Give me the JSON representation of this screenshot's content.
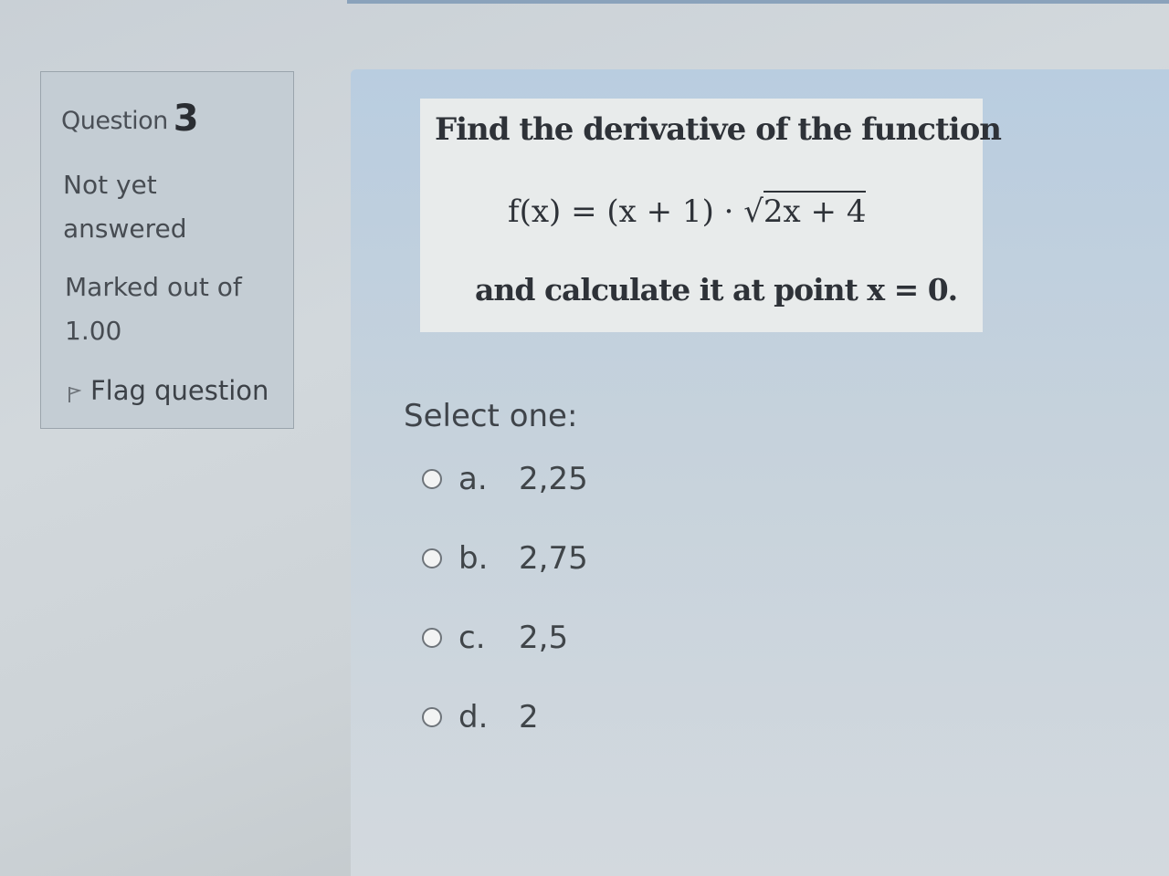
{
  "info": {
    "question_word": "Question",
    "question_number": "3",
    "state_line1": "Not yet",
    "state_line2": "answered",
    "mark_line1": "Marked out of",
    "mark_line2": "1.00",
    "flag_label": "Flag question"
  },
  "question": {
    "heading": "Find the derivative of the function",
    "formula_lhs": "f(x) = (x + 1) · √",
    "formula_radicand": "2x + 4",
    "followup": "and calculate it at point x = 0.",
    "prompt": "Select one:"
  },
  "answers": [
    {
      "letter": "a.",
      "value": "2,25"
    },
    {
      "letter": "b.",
      "value": "2,75"
    },
    {
      "letter": "c.",
      "value": "2,5"
    },
    {
      "letter": "d.",
      "value": "2"
    }
  ],
  "colors": {
    "panel_blue": "#b9cde0",
    "info_box": "#c4cdd4",
    "formula_card": "#e8ebeb"
  }
}
